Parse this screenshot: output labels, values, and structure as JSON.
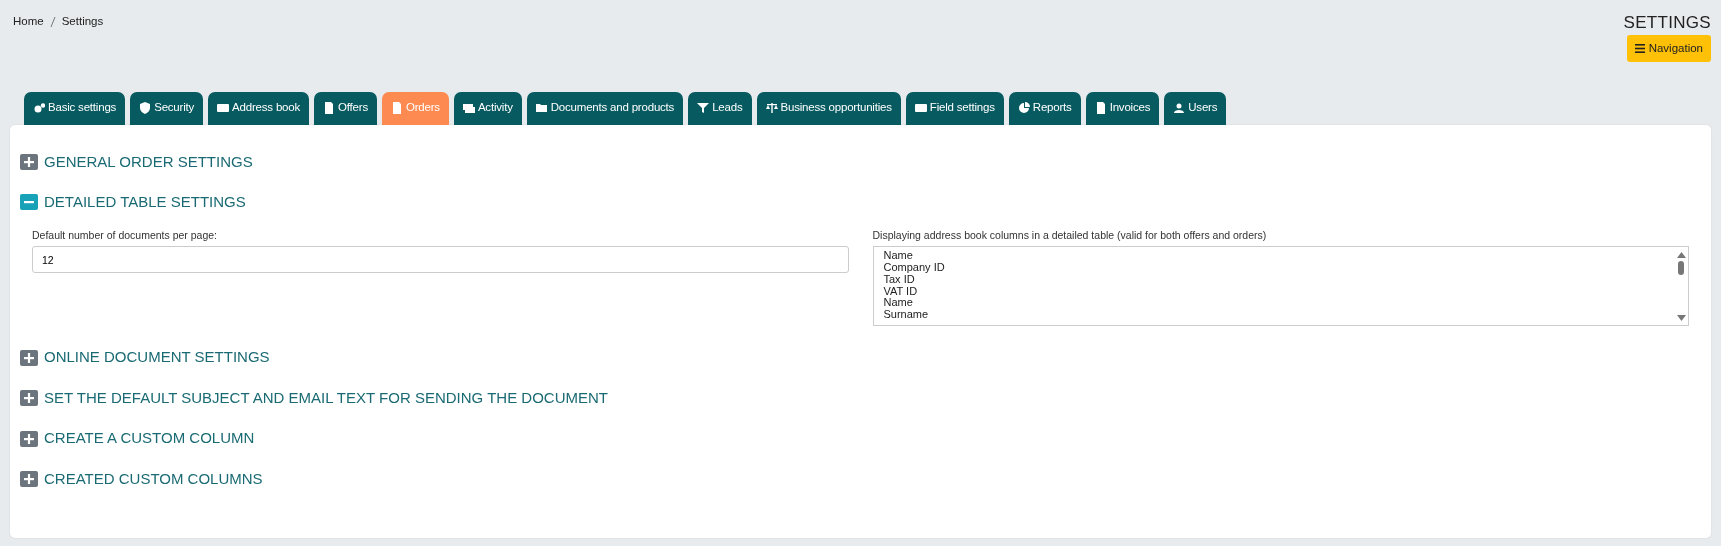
{
  "breadcrumb": [
    {
      "label": "Home"
    },
    {
      "label": "Settings"
    }
  ],
  "page_title": "SETTINGS",
  "navigation_button": "Navigation",
  "tabs": [
    {
      "label": "Basic settings",
      "selected": false
    },
    {
      "label": "Security",
      "selected": false
    },
    {
      "label": "Address book",
      "selected": false
    },
    {
      "label": "Offers",
      "selected": false
    },
    {
      "label": "Orders",
      "selected": true
    },
    {
      "label": "Activity",
      "selected": false
    },
    {
      "label": "Documents and products",
      "selected": false
    },
    {
      "label": "Leads",
      "selected": false
    },
    {
      "label": "Business opportunities",
      "selected": false
    },
    {
      "label": "Field settings",
      "selected": false
    },
    {
      "label": "Reports",
      "selected": false
    },
    {
      "label": "Invoices",
      "selected": false
    },
    {
      "label": "Users",
      "selected": false
    }
  ],
  "sections": [
    {
      "title": "GENERAL ORDER SETTINGS",
      "expanded": false
    },
    {
      "title": "DETAILED TABLE SETTINGS",
      "expanded": true,
      "per_page": {
        "label": "Default number of documents per page:",
        "value": "12"
      },
      "columns_list": {
        "label": "Displaying address book columns in a detailed table (valid for both offers and orders)",
        "options": [
          "Name",
          "Company ID",
          "Tax ID",
          "VAT ID",
          "Name",
          "Surname"
        ]
      }
    },
    {
      "title": "ONLINE DOCUMENT SETTINGS",
      "expanded": false
    },
    {
      "title": "SET THE DEFAULT SUBJECT AND EMAIL TEXT FOR SENDING THE DOCUMENT",
      "expanded": false
    },
    {
      "title": "CREATE A CUSTOM COLUMN",
      "expanded": false
    },
    {
      "title": "CREATED CUSTOM COLUMNS",
      "expanded": false
    }
  ]
}
